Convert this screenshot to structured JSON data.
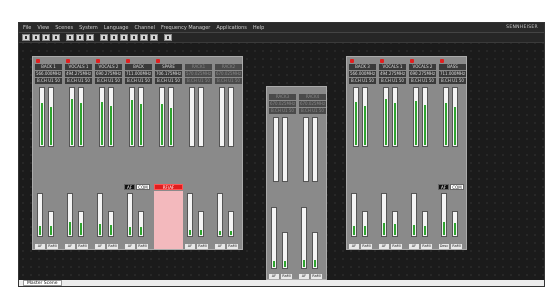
{
  "menu": [
    "File",
    "View",
    "Scenes",
    "System",
    "Language",
    "Channel",
    "Frequency Manager",
    "Applications",
    "Help"
  ],
  "brand": "SENNHEISER",
  "toolbar_icons": [
    "new-icon",
    "open-icon",
    "save-icon",
    "print-icon",
    "cut-icon",
    "copy-icon",
    "paste-icon",
    "screen-icon",
    "screen-icon",
    "screen-icon",
    "user-icon",
    "monitor-icon",
    "list-icon",
    "help-icon"
  ],
  "scene_tab": "Master Scene",
  "banks": [
    {
      "id": "left",
      "channels": [
        {
          "name": "BACK 1",
          "freq": "566.000MHz",
          "info": "B.CH  U1 50",
          "active": true,
          "level": 0.72,
          "rf": 0.22
        },
        {
          "name": "VOCALS 1",
          "freq": "494.275MHz",
          "info": "B.CH  U1 50",
          "active": true,
          "level": 0.8,
          "rf": 0.3
        },
        {
          "name": "VOCALS 2",
          "freq": "690.275MHz",
          "info": "B.CH  U1 50",
          "active": true,
          "level": 0.74,
          "rf": 0.26
        },
        {
          "name": "BACK",
          "freq": "711.000MHz",
          "info": "B.CH  U1 50",
          "active": true,
          "level": 0.78,
          "rf": 0.2
        },
        {
          "name": "SPARE",
          "freq": "706.175MHz",
          "info": "B.CH  U1 50",
          "active": true,
          "level": 0.7,
          "rf": 0.32
        },
        {
          "name": "RACK1",
          "freq": "570.025MHz",
          "info": "B.CH  U1 50",
          "active": false,
          "level": 0.0,
          "rf": 0.12
        },
        {
          "name": "RACK2",
          "freq": "670.025MHz",
          "info": "B.CH  U1 50",
          "active": false,
          "level": 0.0,
          "rf": 0.1
        }
      ],
      "chips": {
        "af": "AF",
        "com": "COM",
        "alert": "RF/AF"
      },
      "footer": [
        "AF",
        "RaMi",
        "AF",
        "RaMi",
        "AF",
        "RaMi",
        "AF",
        "RaMi",
        "Desc",
        "RaMi",
        "AF",
        "RaMi",
        "AF",
        "RaMi"
      ]
    },
    {
      "id": "center",
      "channels": [
        {
          "name": "RACK3",
          "freq": "670.025MHz",
          "info": "B.CH  U1 50",
          "active": false,
          "level": 0.0,
          "rf": 0.1
        },
        {
          "name": "RACK4",
          "freq": "670.025MHz",
          "info": "B.CH  U1 50",
          "active": false,
          "level": 0.0,
          "rf": 0.12
        }
      ],
      "footer": [
        "AF",
        "RaMi",
        "AF",
        "RaMi"
      ]
    },
    {
      "id": "right",
      "channels": [
        {
          "name": "BACK 3",
          "freq": "566.000MHz",
          "info": "B.CH  U1 50",
          "active": true,
          "level": 0.74,
          "rf": 0.22
        },
        {
          "name": "VOCALS 1",
          "freq": "494.275MHz",
          "info": "B.CH  U1 50",
          "active": true,
          "level": 0.8,
          "rf": 0.28
        },
        {
          "name": "VOCALS 2",
          "freq": "690.275MHz",
          "info": "B.CH  U1 50",
          "active": true,
          "level": 0.76,
          "rf": 0.24
        },
        {
          "name": "BASS",
          "freq": "711.000MHz",
          "info": "B.CH  U1 50",
          "active": true,
          "level": 0.72,
          "rf": 0.3
        }
      ],
      "chips": {
        "af": "AF",
        "com": "COM"
      },
      "footer": [
        "AF",
        "RaMi",
        "AF",
        "RaMi",
        "AF",
        "RaMi",
        "Desc",
        "RaMi"
      ]
    }
  ]
}
